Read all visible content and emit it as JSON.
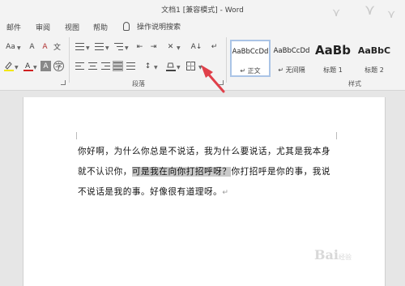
{
  "window": {
    "title": "文档1 [兼容模式] - Word"
  },
  "menu": {
    "items": [
      "邮件",
      "审阅",
      "视图",
      "帮助"
    ],
    "tell_me": "操作说明搜索"
  },
  "ribbon": {
    "font_size_label": "Aa",
    "paragraph_group_label": "段落",
    "styles_group_label": "样式",
    "styles": [
      {
        "sample": "AaBbCcDd",
        "name": "↵ 正文",
        "active": true
      },
      {
        "sample": "AaBbCcDd",
        "name": "↵ 无间隔",
        "active": false
      },
      {
        "sample": "AaBb",
        "name": "标题 1",
        "active": false
      },
      {
        "sample": "AaBbC",
        "name": "标题 2",
        "active": false
      }
    ]
  },
  "document": {
    "text_before": "你好啊，为什么你总是不说话，我为什么要说话，尤其是我本身就不认识你，",
    "highlighted": "可是我在向你打招呼呀？",
    "text_after": "你打招呼是你的事，我说不说话是我的事。好像很有道理呀。",
    "paragraph_mark": "↵"
  },
  "colors": {
    "accent_arrow": "#e0404a",
    "highlight": "#c9c9c9",
    "style_active_border": "#aac4e6"
  },
  "watermark": {
    "text": "Bai",
    "sub": "经验"
  }
}
